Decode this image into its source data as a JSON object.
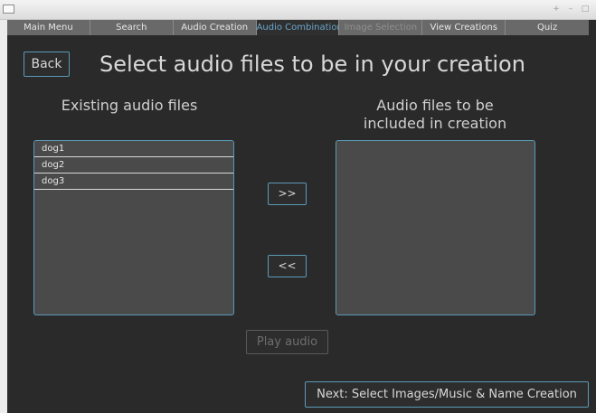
{
  "window": {
    "controls": [
      "+",
      "–",
      "□"
    ]
  },
  "tabs": [
    {
      "label": "Main Menu",
      "state": "normal"
    },
    {
      "label": "Search",
      "state": "normal"
    },
    {
      "label": "Audio Creation",
      "state": "normal"
    },
    {
      "label": "Audio Combination",
      "state": "active"
    },
    {
      "label": "Image Selection",
      "state": "disabled"
    },
    {
      "label": "View Creations",
      "state": "normal"
    },
    {
      "label": "Quiz",
      "state": "normal"
    }
  ],
  "header": {
    "back_label": "Back",
    "title": "Select audio files to be in your creation"
  },
  "existing": {
    "heading": "Existing audio files",
    "items": [
      "dog1",
      "dog2",
      "dog3"
    ]
  },
  "included": {
    "heading": "Audio files to be included in creation",
    "items": []
  },
  "buttons": {
    "add": ">>",
    "remove": "<<",
    "play": "Play audio",
    "next": "Next: Select Images/Music & Name Creation"
  },
  "colors": {
    "background": "#2a2a2a",
    "accent": "#5b9ab8",
    "active_tab_text": "#6aa7cc",
    "list_bg": "#4a4a4a"
  }
}
